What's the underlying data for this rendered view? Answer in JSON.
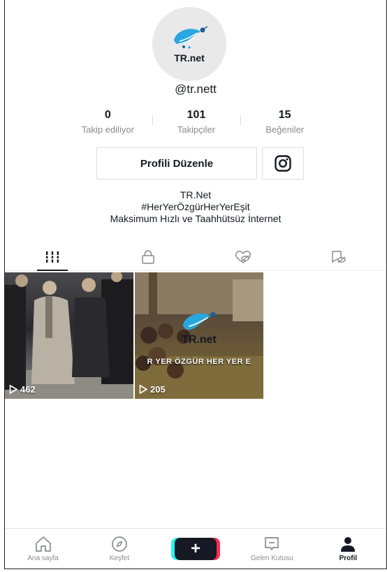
{
  "profile": {
    "avatar_text": "TR.net",
    "username": "@tr.nett"
  },
  "stats": [
    {
      "value": "0",
      "label": "Takip ediliyor"
    },
    {
      "value": "101",
      "label": "Takipçiler"
    },
    {
      "value": "15",
      "label": "Beğeniler"
    }
  ],
  "actions": {
    "edit_profile_label": "Profili Düzenle",
    "instagram_icon": "instagram-icon"
  },
  "bio": {
    "line1": "TR.Net",
    "line2": "#HerYerÖzgürHerYerEşit",
    "line3": "Maksimum Hızlı ve Taahhütsüz İnternet"
  },
  "tabs": [
    {
      "icon": "grid-icon",
      "active": true
    },
    {
      "icon": "lock-icon",
      "active": false
    },
    {
      "icon": "liked-hidden-icon",
      "active": false
    },
    {
      "icon": "saved-hidden-icon",
      "active": false
    }
  ],
  "videos": [
    {
      "views": "462"
    },
    {
      "views": "205",
      "overlay_logo": "TR.net",
      "overlay_banner": "R YER ÖZGÜR HER YER E"
    }
  ],
  "nav": [
    {
      "label": "Ana sayfa",
      "icon": "home-icon"
    },
    {
      "label": "Keşfet",
      "icon": "compass-icon"
    },
    {
      "label": "",
      "icon": "plus-icon"
    },
    {
      "label": "Gelen Kutusu",
      "icon": "inbox-icon"
    },
    {
      "label": "Profil",
      "icon": "profile-icon",
      "active": true
    }
  ],
  "colors": {
    "text_primary": "#161823",
    "text_secondary": "#8a8b91",
    "accent_cyan": "#25f4ee",
    "accent_red": "#fe2c55",
    "logo_blue": "#2aa6e0"
  }
}
